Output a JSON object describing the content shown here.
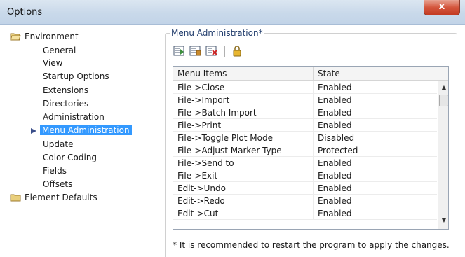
{
  "window": {
    "title": "Options",
    "close_label": "x"
  },
  "tree": {
    "environment": "Environment",
    "items": [
      "General",
      "View",
      "Startup Options",
      "Extensions",
      "Directories",
      "Administration",
      "Menu Administration",
      "Update",
      "Color Coding",
      "Fields",
      "Offsets"
    ],
    "selected": "Menu Administration",
    "element_defaults": "Element Defaults"
  },
  "panel": {
    "group_title": "Menu Administration*",
    "toolbar": [
      "show-all-icon",
      "hide-all-icon",
      "reset-icon",
      "lock-icon"
    ],
    "columns": [
      "Menu Items",
      "State"
    ],
    "rows": [
      [
        "File->Close",
        "Enabled"
      ],
      [
        "File->Import",
        "Enabled"
      ],
      [
        "File->Batch Import",
        "Enabled"
      ],
      [
        "File->Print",
        "Enabled"
      ],
      [
        "File->Toggle Plot Mode",
        "Disabled"
      ],
      [
        "File->Adjust Marker Type",
        "Protected"
      ],
      [
        "File->Send to",
        "Enabled"
      ],
      [
        "File->Exit",
        "Enabled"
      ],
      [
        "Edit->Undo",
        "Enabled"
      ],
      [
        "Edit->Redo",
        "Enabled"
      ],
      [
        "Edit->Cut",
        "Enabled"
      ]
    ],
    "note": "* It is recommended to restart the program to apply the changes."
  },
  "colors": {
    "selection": "#3399ff",
    "close_button": "#d4563d",
    "group_title": "#1e3a6a"
  }
}
